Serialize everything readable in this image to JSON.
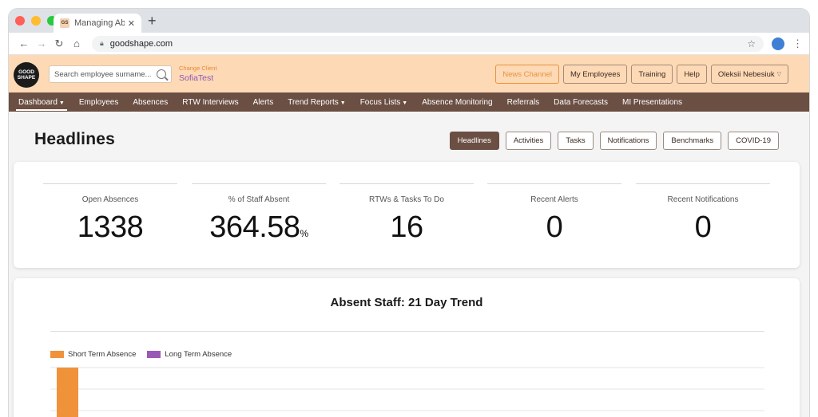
{
  "browser": {
    "tab_title": "Managing Ab",
    "favicon_text": "GS",
    "url": "goodshape.com"
  },
  "header": {
    "logo_text": "GOOD SHAPE",
    "search_placeholder": "Search employee surname...",
    "change_client_label": "Change Client",
    "client_name": "SofiaTest",
    "buttons": {
      "news": "News Channel",
      "employees": "My Employees",
      "training": "Training",
      "help": "Help",
      "user": "Oleksii Nebesiuk"
    }
  },
  "nav": {
    "items": [
      "Dashboard",
      "Employees",
      "Absences",
      "RTW Interviews",
      "Alerts",
      "Trend Reports",
      "Focus Lists",
      "Absence Monitoring",
      "Referrals",
      "Data Forecasts",
      "MI Presentations"
    ]
  },
  "page": {
    "title": "Headlines",
    "tabs": [
      "Headlines",
      "Activities",
      "Tasks",
      "Notifications",
      "Benchmarks",
      "COVID-19"
    ],
    "active_tab": "Headlines"
  },
  "stats": [
    {
      "label": "Open Absences",
      "value": "1338",
      "unit": ""
    },
    {
      "label": "% of Staff Absent",
      "value": "364.58",
      "unit": "%"
    },
    {
      "label": "RTWs & Tasks To Do",
      "value": "16",
      "unit": ""
    },
    {
      "label": "Recent Alerts",
      "value": "0",
      "unit": ""
    },
    {
      "label": "Recent Notifications",
      "value": "0",
      "unit": ""
    }
  ],
  "chart_data": {
    "type": "bar",
    "title": "Absent Staff: 21 Day Trend",
    "legend_position": "top-left",
    "grid": true,
    "series": [
      {
        "name": "Short Term Absence",
        "color": "#f0923a"
      },
      {
        "name": "Long Term Absence",
        "color": "#9b59b6"
      }
    ]
  }
}
